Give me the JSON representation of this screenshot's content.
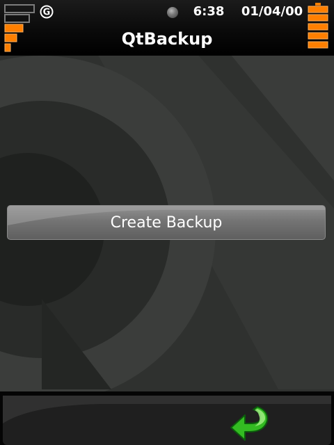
{
  "status_bar": {
    "network_type": "G",
    "clock": "6:38",
    "date": "01/04/00",
    "signal_icon": "signal-strength-icon",
    "battery_icon": "battery-icon",
    "indicator_icon": "status-dot-icon"
  },
  "header": {
    "title": "QtBackup"
  },
  "main": {
    "create_backup_label": "Create Backup"
  },
  "bottom_bar": {
    "back_icon": "back-arrow-icon"
  },
  "colors": {
    "accent": "#ff7f00",
    "back_arrow": "#33bb22",
    "background": "#2e302e"
  }
}
